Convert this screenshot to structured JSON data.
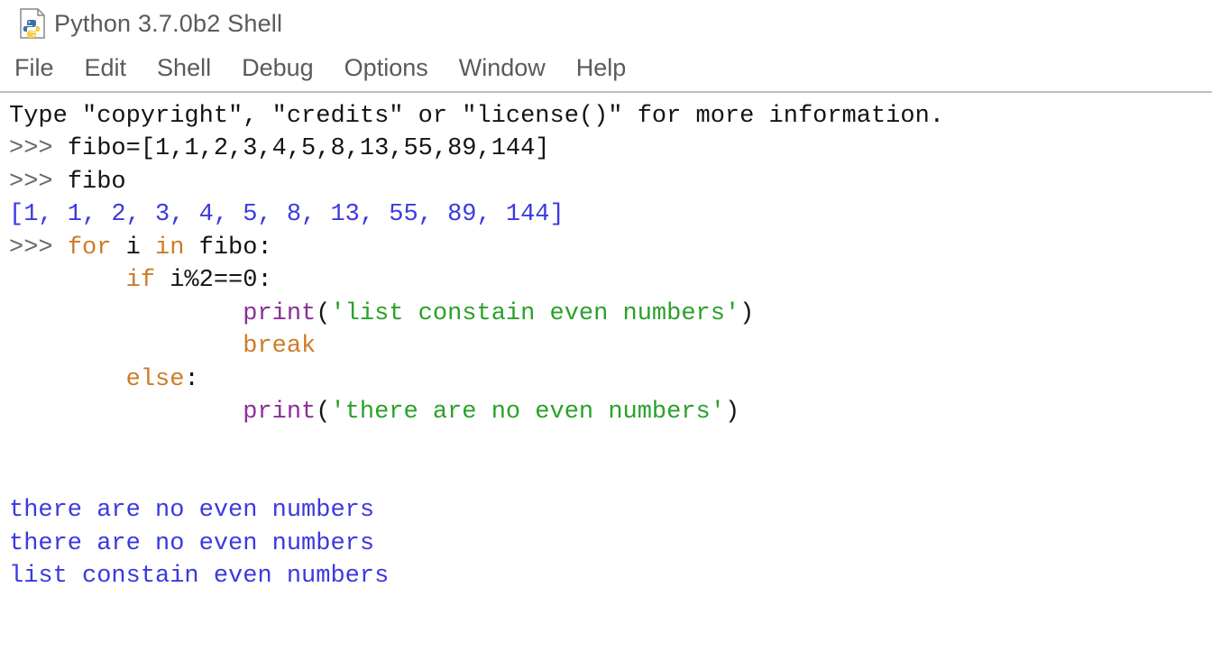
{
  "window": {
    "title": "Python 3.7.0b2 Shell",
    "icon": "python-file-icon"
  },
  "menu": {
    "file": "File",
    "edit": "Edit",
    "shell": "Shell",
    "debug": "Debug",
    "options": "Options",
    "window": "Window",
    "help": "Help"
  },
  "shell": {
    "info_line": "Type \"copyright\", \"credits\" or \"license()\" for more information.",
    "prompt": ">>> ",
    "input1": "fibo=[1,1,2,3,4,5,8,13,55,89,144]",
    "input2": "fibo",
    "output_list": "[1, 1, 2, 3, 4, 5, 8, 13, 55, 89, 144]",
    "code": {
      "for_kw": "for",
      "for_rest": " i ",
      "in_kw": "in",
      "in_rest": " fibo:",
      "if_kw": "if",
      "if_rest": " i%2==0:",
      "print1_fn": "print",
      "print1_paren_open": "(",
      "print1_str": "'list constain even numbers'",
      "print1_paren_close": ")",
      "break_kw": "break",
      "else_kw": "else",
      "else_colon": ":",
      "print2_fn": "print",
      "print2_paren_open": "(",
      "print2_str": "'there are no even numbers'",
      "print2_paren_close": ")"
    },
    "out1": "there are no even numbers",
    "out2": "there are no even numbers",
    "out3": "list constain even numbers"
  }
}
